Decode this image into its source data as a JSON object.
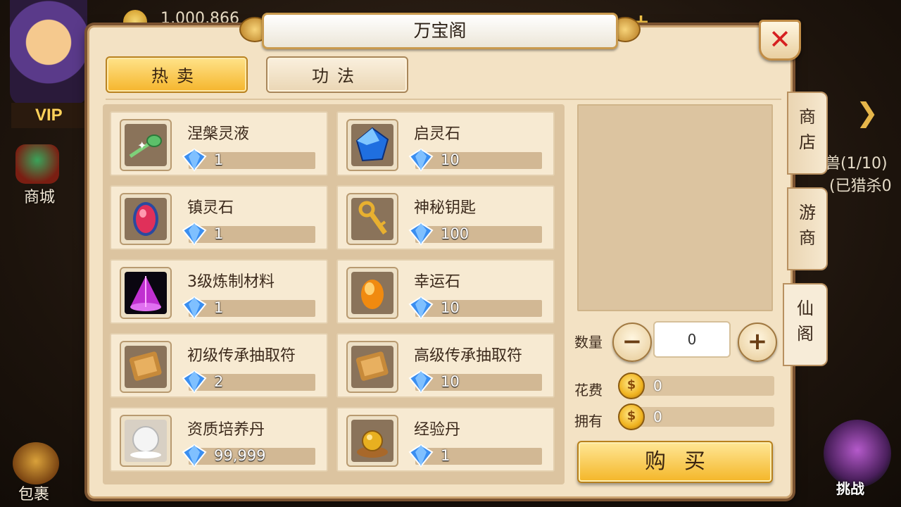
{
  "hud": {
    "vip_label": "VIP",
    "gold_amount": "1,000,866",
    "mall_label": "商城",
    "bag_label": "包裹",
    "quest_line1": "兽(1/10)",
    "quest_line2": "(已猎杀0",
    "challenge_label": "挑战"
  },
  "dialog": {
    "title": "万宝阁",
    "close_icon": "close-x-icon",
    "tabs": [
      {
        "label": "热卖",
        "active": true
      },
      {
        "label": "功法",
        "active": false
      }
    ],
    "side_tabs": [
      "商店",
      "游商",
      "仙阁"
    ],
    "items": [
      {
        "name": "涅槃灵液",
        "price": "1",
        "icon": "green-pill-icon"
      },
      {
        "name": "启灵石",
        "price": "10",
        "icon": "blue-crystal-icon"
      },
      {
        "name": "镇灵石",
        "price": "1",
        "icon": "red-gem-icon"
      },
      {
        "name": "神秘钥匙",
        "price": "100",
        "icon": "golden-key-icon"
      },
      {
        "name": "3级炼制材料",
        "price": "1",
        "icon": "purple-cone-icon"
      },
      {
        "name": "幸运石",
        "price": "10",
        "icon": "amber-stone-icon"
      },
      {
        "name": "初级传承抽取符",
        "price": "2",
        "icon": "scroll-icon"
      },
      {
        "name": "高级传承抽取符",
        "price": "10",
        "icon": "scroll-icon"
      },
      {
        "name": "资质培养丹",
        "price": "99,999",
        "icon": "white-pill-icon"
      },
      {
        "name": "经验丹",
        "price": "1",
        "icon": "golden-pill-icon"
      }
    ],
    "detail": {
      "quantity_label": "数量",
      "quantity_value": "0",
      "cost_label": "花费",
      "cost_value": "0",
      "owned_label": "拥有",
      "owned_value": "0",
      "buy_label": "购买"
    }
  },
  "colors": {
    "panel_bg": "#f3e2c4",
    "accent_gold": "#f5b52c",
    "close_red": "#d62020",
    "price_gem": "#2f7fe0"
  }
}
